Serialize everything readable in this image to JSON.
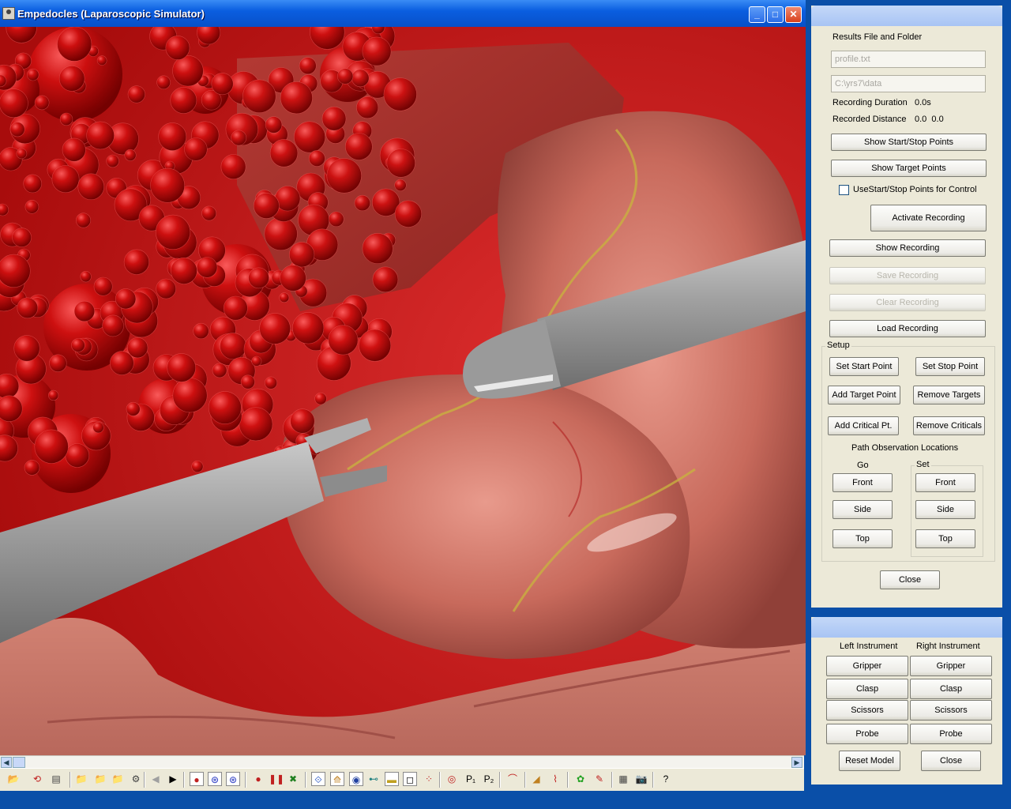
{
  "window": {
    "title": "Empedocles (Laparoscopic Simulator)",
    "minimize": "_",
    "maximize": "□",
    "close": "✕"
  },
  "recording_panel": {
    "results_label": "Results File and Folder",
    "file_field": "profile.txt",
    "folder_field": "C:\\yrs7\\data",
    "duration_label": "Recording Duration",
    "duration_value": "0.0s",
    "distance_label": "Recorded Distance",
    "distance_value": "0.0  0.0",
    "show_start_stop": "Show Start/Stop Points",
    "show_targets": "Show Target Points",
    "use_start_stop": "UseStart/Stop Points for Control",
    "use_start_stop_checked": false,
    "activate_recording": "Activate Recording",
    "show_recording": "Show Recording",
    "save_recording": "Save Recording",
    "clear_recording": "Clear Recording",
    "load_recording": "Load Recording",
    "setup_label": "Setup",
    "set_start": "Set Start Point",
    "set_stop": "Set Stop Point",
    "add_target": "Add Target Point",
    "remove_targets": "Remove Targets",
    "add_critical": "Add Critical Pt.",
    "remove_criticals": "Remove Criticals",
    "path_obs_label": "Path Observation Locations",
    "go_label": "Go",
    "set_label": "Set",
    "go_front": "Front",
    "go_side": "Side",
    "go_top": "Top",
    "set_front": "Front",
    "set_side": "Side",
    "set_top": "Top",
    "close": "Close"
  },
  "instrument_panel": {
    "left_label": "Left Instrument",
    "right_label": "Right Instrument",
    "left": [
      "Gripper",
      "Clasp",
      "Scissors",
      "Probe"
    ],
    "right": [
      "Gripper",
      "Clasp",
      "Scissors",
      "Probe"
    ],
    "reset_model": "Reset Model",
    "close": "Close"
  },
  "scrollbar": {
    "left_arrow": "◀",
    "right_arrow": "▶"
  },
  "toolbar": {
    "icons": [
      "open-folder-icon",
      "flag-icon",
      "document-icon",
      "open-file-icon",
      "open-file2-icon",
      "open-file3-icon",
      "gear-icon",
      "step-back-icon",
      "play-icon",
      "record-icon",
      "go-record-icon",
      "go-record2-icon",
      "red-dot-icon",
      "pause-icon",
      "cross-icon",
      "view-icon",
      "arrows-icon",
      "eye-icon",
      "link-icon",
      "layers-icon",
      "frame-icon",
      "scatter-icon",
      "target-icon",
      "p1-icon",
      "p2-icon",
      "tissue-icon",
      "ramp-icon",
      "graph-icon",
      "green-icon",
      "red-tool-icon",
      "film-icon",
      "camera-icon",
      "help-icon"
    ],
    "glyphs": [
      "📂",
      "⟲",
      "▤",
      "📁",
      "📁",
      "📁",
      "⚙",
      "◀",
      "▶",
      "●",
      "⊛",
      "⊛",
      "●",
      "❚❚",
      "✖",
      "⟐",
      "⟰",
      "◉",
      "⊷",
      "▬",
      "◻",
      "⁘",
      "◎",
      "P₁",
      "P₂",
      "⌒",
      "◢",
      "⌇",
      "✿",
      "✎",
      "▦",
      "📷",
      "?"
    ]
  },
  "colors": {
    "titlebar": "#0a5ee0",
    "panel_bg": "#ece9d8",
    "viewport_bg": "#c41818"
  }
}
